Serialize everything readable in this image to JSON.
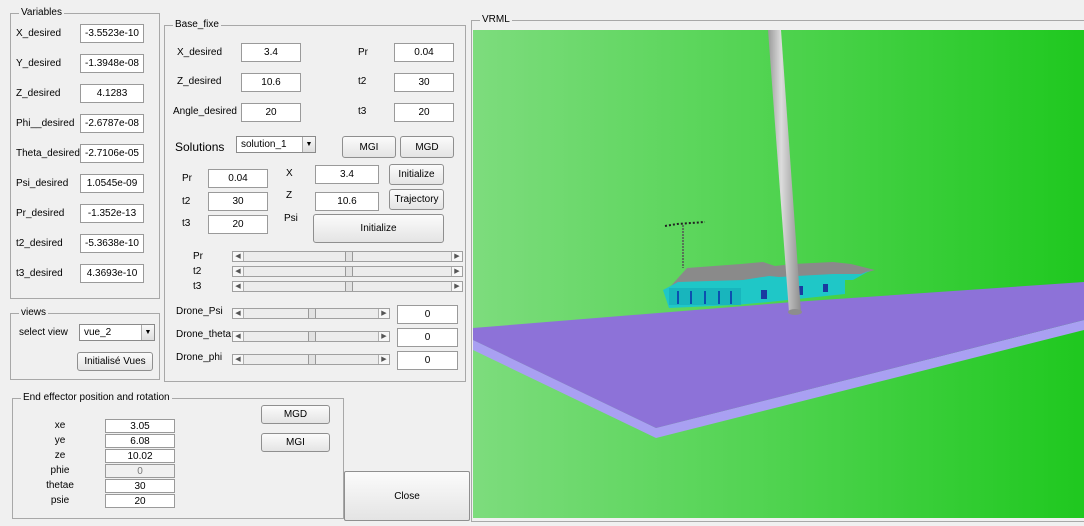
{
  "variables": {
    "title": "Variables",
    "rows": [
      {
        "label": "X_desired",
        "value": "-3.5523e-10"
      },
      {
        "label": "Y_desired",
        "value": "-1.3948e-08"
      },
      {
        "label": "Z_desired",
        "value": "4.1283"
      },
      {
        "label": "Phi__desired",
        "value": "-2.6787e-08"
      },
      {
        "label": "Theta_desired",
        "value": "-2.7106e-05"
      },
      {
        "label": "Psi_desired",
        "value": "1.0545e-09"
      },
      {
        "label": "Pr_desired",
        "value": "-1.352e-13"
      },
      {
        "label": "t2_desired",
        "value": "-5.3638e-10"
      },
      {
        "label": "t3_desired",
        "value": "4.3693e-10"
      }
    ]
  },
  "views": {
    "title": "views",
    "select_label": "select view",
    "selected": "vue_2",
    "init_button": "Initialisé Vues"
  },
  "base_fixe": {
    "title": "Base_fixe",
    "x_label": "X_desired",
    "x_value": "3.4",
    "z_label": "Z_desired",
    "z_value": "10.6",
    "angle_label": "Angle_desired",
    "angle_value": "20",
    "pr_label": "Pr",
    "pr_value": "0.04",
    "t2_label": "t2",
    "t2_value": "30",
    "t3_label": "t3",
    "t3_value": "20",
    "solutions_label": "Solutions",
    "solutions_selected": "solution_1",
    "mgi_button": "MGI",
    "mgd_button": "MGD",
    "pr2_label": "Pr",
    "pr2_value": "0.04",
    "t2b_label": "t2",
    "t2b_value": "30",
    "t3b_label": "t3",
    "t3b_value": "20",
    "X_label": "X",
    "X_value": "3.4",
    "Z_label": "Z",
    "Z_value": "10.6",
    "Psi_label": "Psi",
    "initialize_small": "Initialize",
    "trajectory_button": "Trajectory",
    "initialize_large": "Initialize",
    "sliders": [
      {
        "label": "Pr",
        "level": 0.5
      },
      {
        "label": "t2",
        "level": 0.5
      },
      {
        "label": "t3",
        "level": 0.5
      }
    ],
    "drone_sliders": [
      {
        "label": "Drone_Psi",
        "level": 0.5,
        "value": "0"
      },
      {
        "label": "Drone_theta",
        "level": 0.5,
        "value": "0"
      },
      {
        "label": "Drone_phi",
        "level": 0.5,
        "value": "0"
      }
    ]
  },
  "end_effector": {
    "title": "End effector position and rotation",
    "rows": [
      {
        "label": "xe",
        "value": "3.05"
      },
      {
        "label": "ye",
        "value": "6.08"
      },
      {
        "label": "ze",
        "value": "10.02"
      },
      {
        "label": "phie",
        "value": "0"
      },
      {
        "label": "thetae",
        "value": "30"
      },
      {
        "label": "psie",
        "value": "20"
      }
    ],
    "mgd_button": "MGD",
    "mgi_button": "MGI"
  },
  "close_button": "Close",
  "vrml": {
    "title": "VRML",
    "colors": {
      "ground": "#22cc22",
      "platform": "#8b6fd6",
      "platform_edge": "#a89cf0",
      "pole": "#b8b8b8",
      "house": "#1fc7c7",
      "roof": "#8a8a8a"
    }
  }
}
